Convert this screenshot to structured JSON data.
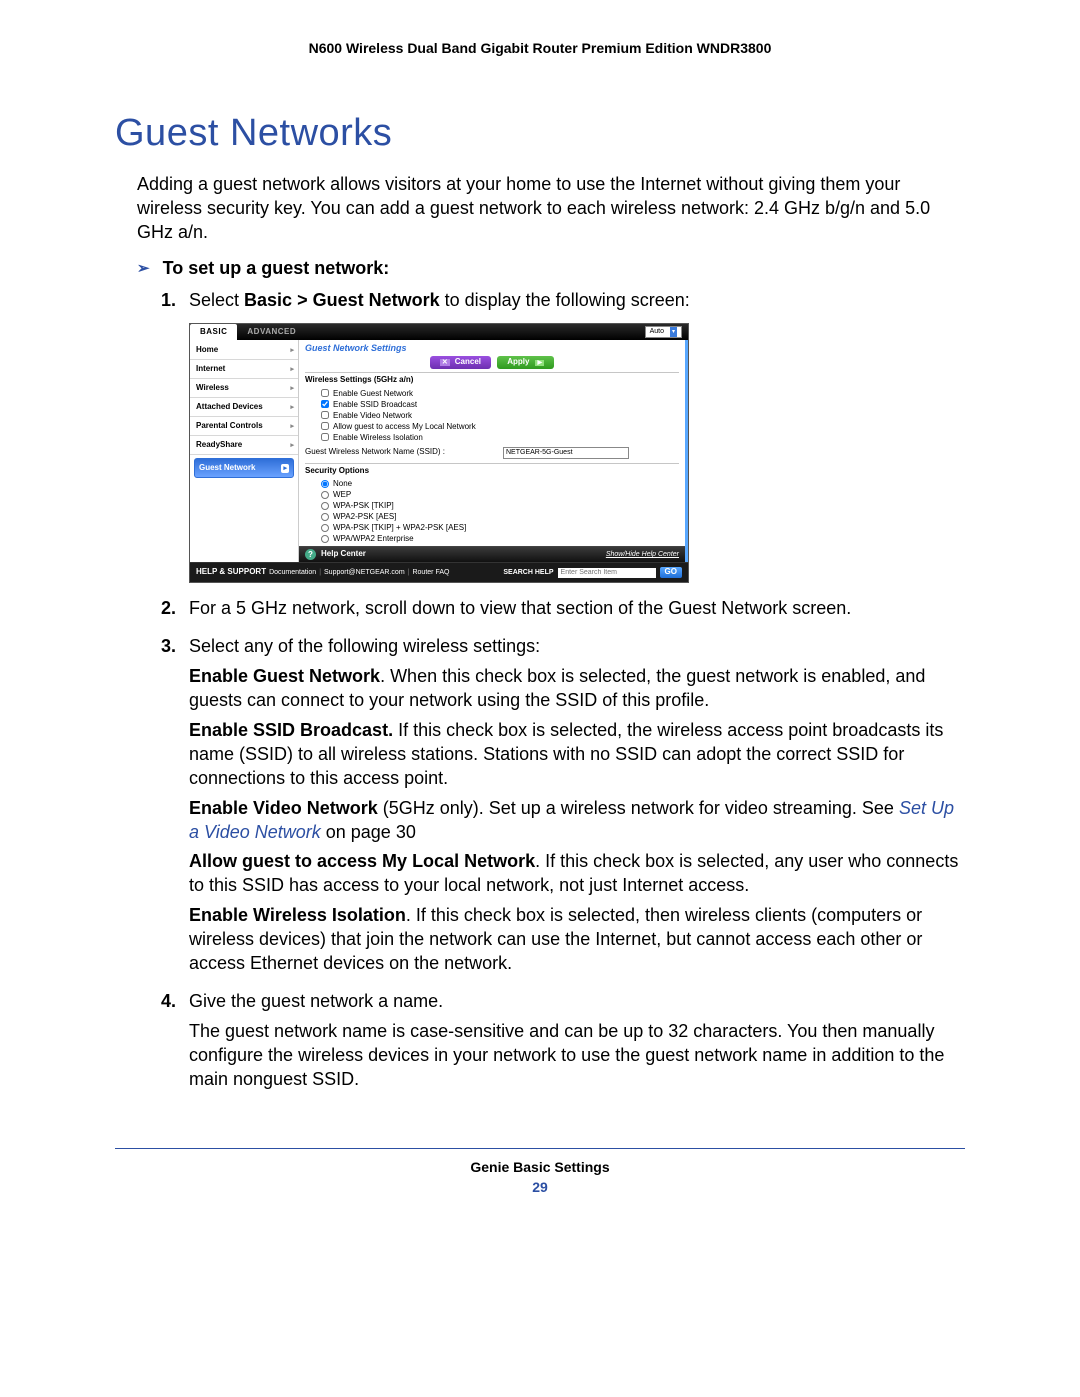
{
  "header": "N600 Wireless Dual Band Gigabit Router Premium Edition WNDR3800",
  "title": "Guest Networks",
  "intro": "Adding a guest network allows visitors at your home to use the Internet without giving them your wireless security key. You can add a guest network to each wireless network: 2.4 GHz b/g/n and 5.0 GHz a/n.",
  "task_heading": "To set up a guest network:",
  "step1_prefix": "Select ",
  "step1_bold": "Basic > Guest Network",
  "step1_suffix": " to display the following screen:",
  "step2": "For a 5 GHz network, scroll down to view that section of the Guest Network screen.",
  "step3": "Select any of the following wireless settings:",
  "opt_enable_guest_b": "Enable Guest Network",
  "opt_enable_guest_t": ". When this check box is selected, the guest network is enabled, and guests can connect to your network using the SSID of this profile.",
  "opt_ssid_b": "Enable SSID Broadcast.",
  "opt_ssid_t": " If this check box is selected, the wireless access point broadcasts its name (SSID) to all wireless stations. Stations with no SSID can adopt the correct SSID for connections to this access point.",
  "opt_video_b": "Enable Video Network",
  "opt_video_t": " (5GHz only). Set up a wireless network for video streaming. See ",
  "opt_video_link": "Set Up a Video Network",
  "opt_video_pg": " on page 30",
  "opt_local_b": "Allow guest to access My Local Network",
  "opt_local_t": ". If this check box is selected, any user who connects to this SSID has access to your local network, not just Internet access.",
  "opt_iso_b": "Enable Wireless Isolation",
  "opt_iso_t": ". If this check box is selected, then wireless clients (computers or wireless devices) that join the network can use the Internet, but cannot access each other or access Ethernet devices on the network.",
  "step4": "Give the guest network a name.",
  "step4_detail": "The guest network name is case-sensitive and can be up to 32 characters. You then manually configure the wireless devices in your network to use the guest network name in addition to the main nonguest SSID.",
  "footer": "Genie Basic Settings",
  "page_number": "29",
  "ui": {
    "tabs": {
      "basic": "BASIC",
      "advanced": "ADVANCED"
    },
    "auto_label": "Auto",
    "sidebar": [
      "Home",
      "Internet",
      "Wireless",
      "Attached Devices",
      "Parental Controls",
      "ReadyShare",
      "Guest Network"
    ],
    "panel_title": "Guest Network Settings",
    "cancel": "Cancel",
    "apply": "Apply",
    "section_5g": "Wireless Settings (5GHz a/n)",
    "cb": {
      "enable_guest": "Enable Guest Network",
      "enable_ssid": "Enable SSID Broadcast",
      "enable_video": "Enable Video Network",
      "allow_local": "Allow guest to access My Local Network",
      "enable_iso": "Enable Wireless Isolation"
    },
    "ssid_label": "Guest Wireless Network Name (SSID) :",
    "ssid_value": "NETGEAR-5G-Guest",
    "security_label": "Security Options",
    "security": [
      "None",
      "WEP",
      "WPA-PSK [TKIP]",
      "WPA2-PSK [AES]",
      "WPA-PSK [TKIP] + WPA2-PSK [AES]",
      "WPA/WPA2 Enterprise"
    ],
    "help_center": "Help Center",
    "showhide": "Show/Hide Help Center",
    "support_label": "HELP & SUPPORT",
    "support_links": [
      "Documentation",
      "Support@NETGEAR.com",
      "Router FAQ"
    ],
    "search_label": "SEARCH HELP",
    "search_placeholder": "Enter Search Item",
    "go": "GO"
  }
}
